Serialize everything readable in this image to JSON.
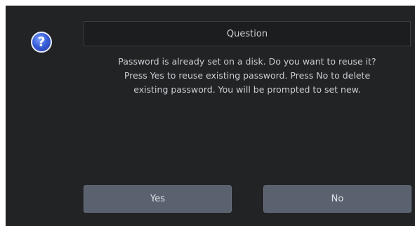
{
  "dialog": {
    "title": "Question",
    "help_icon_glyph": "?",
    "icon": "question-mark-icon",
    "message_lines": [
      "Password is already set on a disk. Do you want to reuse it?",
      "Press Yes to reuse existing password. Press No to delete",
      "existing password. You will be prompted to set new."
    ],
    "yes_label": "Yes",
    "no_label": "No"
  },
  "colors": {
    "background": "#222325",
    "button": "#5a6270",
    "text": "#c9cdd2",
    "icon": "#3a5fd9"
  }
}
